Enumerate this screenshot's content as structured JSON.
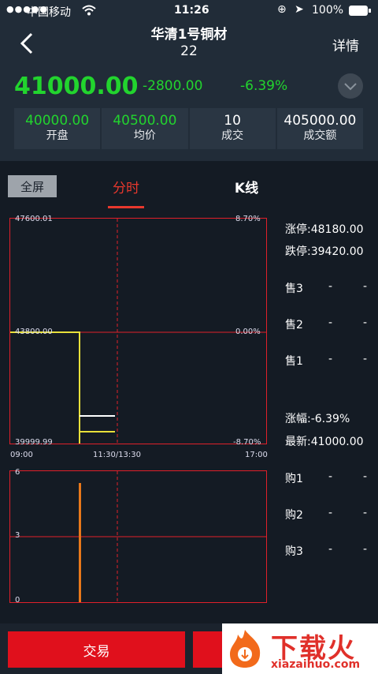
{
  "status": {
    "carrier": "中国移动",
    "time": "11:26",
    "battery": "100%"
  },
  "nav": {
    "title": "华清1号铜材",
    "subtitle": "22",
    "detail": "详情"
  },
  "quote": {
    "price": "41000.00",
    "change": "-2800.00",
    "pct": "-6.39%"
  },
  "stats": [
    {
      "value": "40000.00",
      "label": "开盘",
      "green": true
    },
    {
      "value": "40500.00",
      "label": "均价",
      "green": true
    },
    {
      "value": "10",
      "label": "成交",
      "green": false
    },
    {
      "value": "405000.00",
      "label": "成交额",
      "green": false
    }
  ],
  "tabs": {
    "fullscreen": "全屏",
    "fenshi": "分时",
    "kline": "K线"
  },
  "chart": {
    "y_top": "47600.01",
    "y_mid": "43800.00",
    "y_bot": "39999.99",
    "pct_top": "8.70%",
    "pct_mid": "0.00%",
    "pct_bot": "-8.70%",
    "x_start": "09:00",
    "x_mid": "11:30/13:30",
    "x_end": "17:00"
  },
  "volume": {
    "y6": "6",
    "y3": "3",
    "y0": "0"
  },
  "side": {
    "limit_up": "涨停:48180.00",
    "limit_down": "跌停:39420.00",
    "asks": [
      {
        "label": "售3",
        "p": "-",
        "q": "-"
      },
      {
        "label": "售2",
        "p": "-",
        "q": "-"
      },
      {
        "label": "售1",
        "p": "-",
        "q": "-"
      }
    ],
    "change": "涨幅:-6.39%",
    "latest": "最新:41000.00",
    "bids": [
      {
        "label": "购1",
        "p": "-",
        "q": "-"
      },
      {
        "label": "购2",
        "p": "-",
        "q": "-"
      },
      {
        "label": "购3",
        "p": "-",
        "q": "-"
      }
    ]
  },
  "bottom": {
    "trade": "交易"
  },
  "watermark": {
    "cn": "下载火",
    "url": "xiazaihuo.com"
  }
}
